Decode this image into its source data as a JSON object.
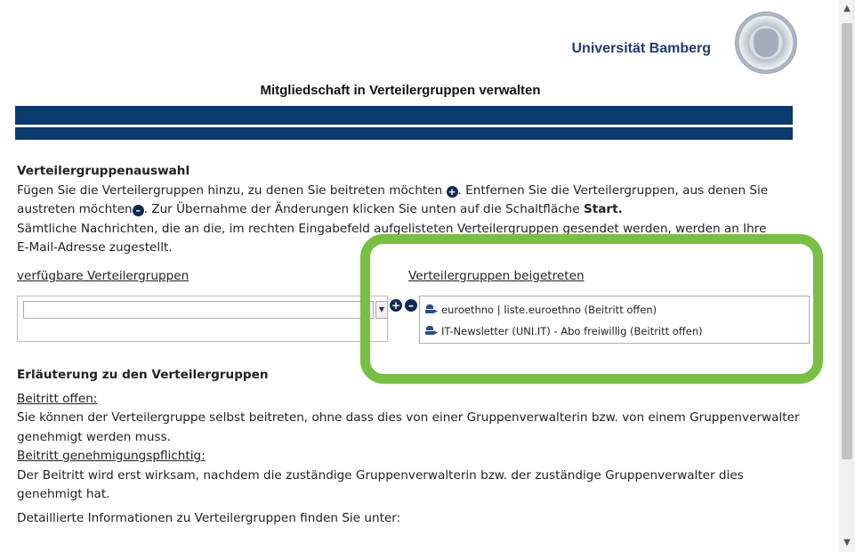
{
  "header": {
    "brand": "Universität Bamberg",
    "logo_icon": "university-seal-icon",
    "title": "Mitgliedschaft in Verteilergruppen verwalten"
  },
  "section": {
    "heading": "Verteilergruppenauswahl",
    "intro_1": "Fügen Sie die Verteilergruppen hinzu, zu denen Sie beitreten möchten",
    "intro_2": ". Entfernen Sie die Verteilergruppen, aus denen Sie",
    "intro_3": "austreten möchten",
    "intro_4": ". Zur Übernahme der Änderungen klicken Sie unten auf die Schaltfläche",
    "intro_start": "Start.",
    "intro_5": "Sämtliche Nachrichten, die an die, im rechten Eingabefeld aufgelisteten Verteilergruppen gesendet werden, werden an Ihre",
    "intro_6": "E-Mail-Adresse zugestellt."
  },
  "available": {
    "label": "verfügbare Verteilergruppen",
    "selected": ""
  },
  "joined": {
    "label": "Verteilergruppen beigetreten",
    "items": [
      "euroethno | liste.euroethno (Beitritt offen)",
      "IT-Newsletter (UNI.IT) - Abo freiwillig (Beitritt offen)"
    ]
  },
  "explanation": {
    "heading": "Erläuterung zu den Verteilergruppen",
    "open_label": "Beitritt offen:",
    "open_text_1": "Sie können der Verteilergruppe selbst beitreten, ohne dass dies von einer Gruppenverwalterin bzw. von einem Gruppenverwalter",
    "open_text_2": "genehmigt werden muss.",
    "approval_label": "Beitritt genehmigungspflichtig:",
    "approval_text_1": "Der Beitritt wird erst wirksam, nachdem die zuständige Gruppenverwalterin bzw. der zuständige Gruppenverwalter dies",
    "approval_text_2": "genehmigt hat.",
    "more_info": "Detaillierte Informationen zu Verteilergruppen finden Sie unter:"
  },
  "icons": {
    "add": "plus-circle-icon",
    "remove": "minus-circle-icon",
    "group": "distribution-group-icon"
  },
  "colors": {
    "navy": "#0b3a6e",
    "brand_blue": "#1e3a78",
    "highlight_green": "#77c043"
  }
}
